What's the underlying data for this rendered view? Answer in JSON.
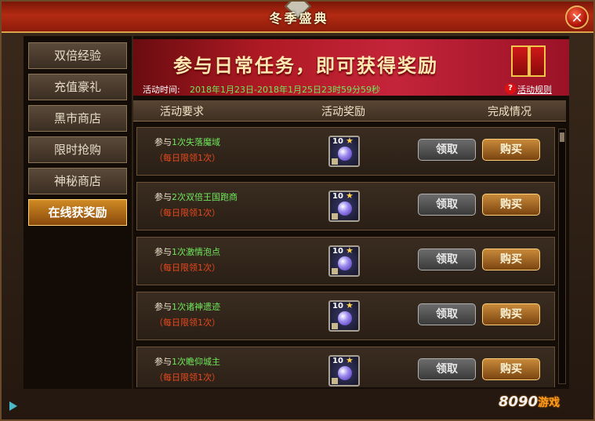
{
  "window": {
    "title": "冬季盛典",
    "close_label": "✕"
  },
  "sidebar": {
    "items": [
      {
        "label": "双倍经验"
      },
      {
        "label": "充值豪礼"
      },
      {
        "label": "黑市商店"
      },
      {
        "label": "限时抢购"
      },
      {
        "label": "神秘商店"
      },
      {
        "label": "在线获奖励",
        "active": true
      }
    ]
  },
  "banner": {
    "title": "参与日常任务，即可获得奖励",
    "time_label": "活动时间:",
    "time_value": "2018年1月23日-2018年1月25日23时59分59秒",
    "rule_icon": "?",
    "rule_link": "活动规则"
  },
  "table": {
    "headers": [
      "活动要求",
      "活动奖励",
      "完成情况"
    ],
    "rows": [
      {
        "prefix": "参与",
        "count": "1次",
        "name": "失落魔域",
        "limit": "（每日限领1次）",
        "reward_level": "10",
        "claim": "领取",
        "buy": "购买"
      },
      {
        "prefix": "参与",
        "count": "2次",
        "name": "双倍王国跑商",
        "limit": "（每日限领1次）",
        "reward_level": "10",
        "claim": "领取",
        "buy": "购买"
      },
      {
        "prefix": "参与",
        "count": "1次",
        "name": "激情泡点",
        "limit": "（每日限领1次）",
        "reward_level": "10",
        "claim": "领取",
        "buy": "购买"
      },
      {
        "prefix": "参与",
        "count": "1次",
        "name": "诸神遗迹",
        "limit": "（每日限领1次）",
        "reward_level": "10",
        "claim": "领取",
        "buy": "购买"
      },
      {
        "prefix": "参与",
        "count": "1次",
        "name": "瞻仰城主",
        "limit": "（每日限领1次）",
        "reward_level": "10",
        "claim": "领取",
        "buy": "购买"
      }
    ]
  },
  "watermark": {
    "text": "8090",
    "suffix": "游戏"
  },
  "colors": {
    "accent": "#b32a12",
    "green": "#6fe85c",
    "limit_red": "#e9481c"
  }
}
